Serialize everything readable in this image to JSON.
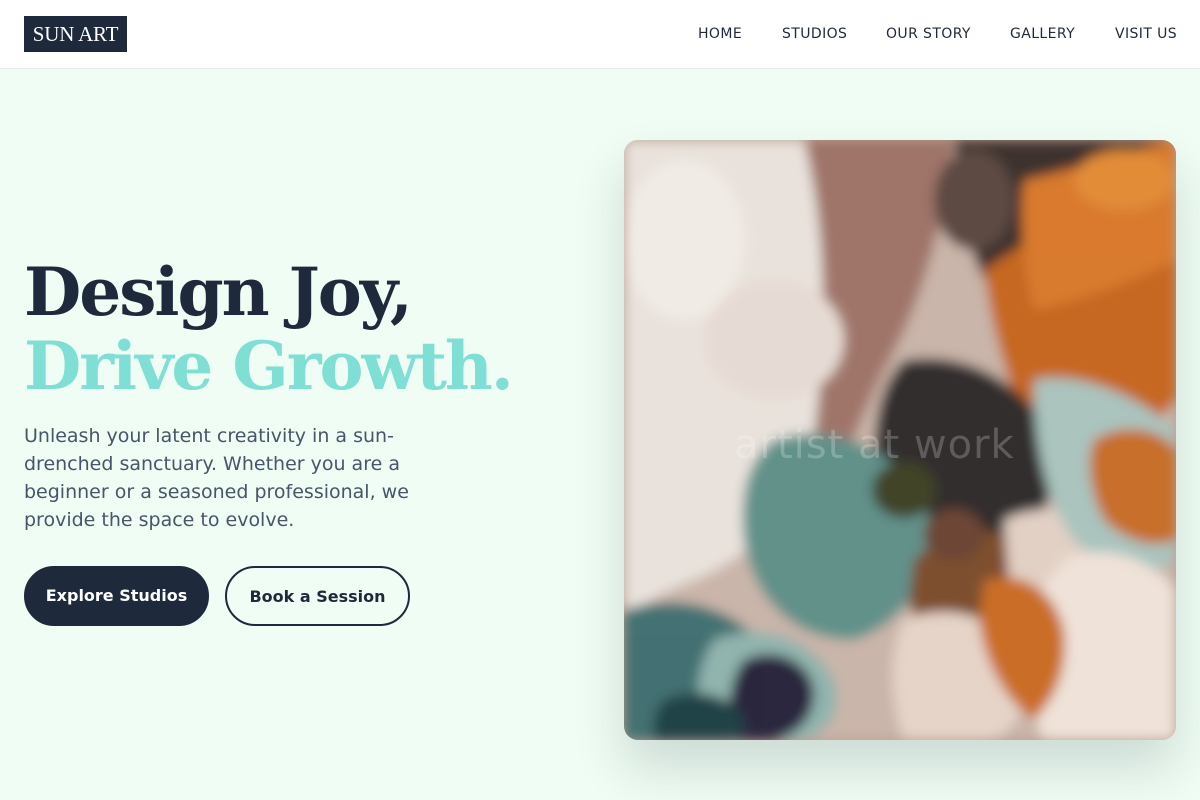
{
  "brand": {
    "logo_text": "SUN ART"
  },
  "nav": {
    "items": [
      {
        "label": "HOME"
      },
      {
        "label": "STUDIOS"
      },
      {
        "label": "OUR STORY"
      },
      {
        "label": "GALLERY"
      },
      {
        "label": "VISIT US"
      }
    ]
  },
  "hero": {
    "title_line1": "Design Joy,",
    "title_line2": "Drive Growth.",
    "description": "Unleash your latent creativity in a sun-drenched sanctuary. Whether you are a beginner or a seasoned professional, we provide the space to evolve.",
    "primary_button": "Explore Studios",
    "secondary_button": "Book a Session"
  },
  "artwork": {
    "watermark_text": "artist at work"
  },
  "colors": {
    "background": "#effdf4",
    "navy": "#1e293b",
    "accent_teal": "#7fdfd4",
    "body_text": "#475569"
  }
}
